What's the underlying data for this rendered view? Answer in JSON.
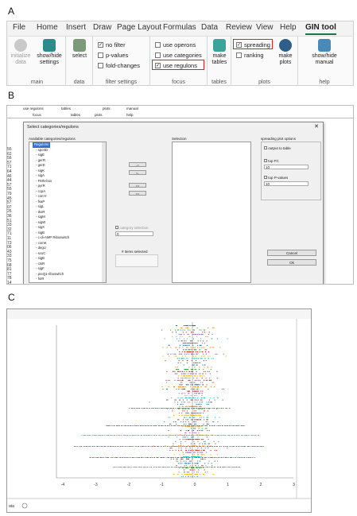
{
  "labels": {
    "a": "A",
    "b": "B",
    "c": "C"
  },
  "ribbon": {
    "tabs": [
      "File",
      "Home",
      "Insert",
      "Draw",
      "Page Layout",
      "Formulas",
      "Data",
      "Review",
      "View",
      "Help",
      "GIN tool"
    ],
    "active_tab": "GIN tool",
    "groups": {
      "main": "main",
      "data": "data",
      "filter": "filter settings",
      "focus": "focus",
      "tables": "tables",
      "plots": "plots",
      "help": "help"
    },
    "buttons": {
      "initialize": "initialize data",
      "showhide": "show/hide settings",
      "select": "select",
      "make_tables": "make tables",
      "make_plots": "make plots",
      "manual": "show/hide manual"
    },
    "checks": {
      "no_filter": "no filter",
      "pvalues": "p-values",
      "fold": "fold-changes",
      "operons": "use operons",
      "categories": "use categories",
      "regulons": "use regulons",
      "spreading": "spreading",
      "ranking": "ranking"
    },
    "colors": {
      "accent": "#217346",
      "highlight": "#d22222"
    }
  },
  "dialog": {
    "title": "Select categories/regulons",
    "close": "✕",
    "available_label": "Available categories/regulons",
    "selection_label": "Selection",
    "options_label": "spreading plot options",
    "output_table": "output to table",
    "top_fc": "top FC",
    "top_fc_val": "10",
    "top_p": "top P-values",
    "top_p_val": "10",
    "category_selection": "category selection",
    "category_val": "0",
    "items_selected": "# items selected",
    "cancel": "Cancel",
    "ok": "Ok",
    "bg_headers": [
      "use regulons",
      "tables",
      "plots",
      "manual",
      "focus",
      "tables",
      "plots",
      "help"
    ],
    "row_numbers": [
      "55",
      "62",
      "56",
      "57",
      "71",
      "64",
      "46",
      "44",
      "57",
      "55",
      "79",
      "45",
      "57",
      "07",
      "26",
      "36",
      "51",
      "33",
      "32",
      "71",
      "11",
      "73",
      "06",
      "43",
      "33",
      "75",
      "68",
      "81",
      "77",
      "78",
      "14"
    ],
    "items": [
      "Regulons",
      "spoIID",
      "sigE",
      "gerR",
      "gerE",
      "sigK",
      "sigA",
      "FMN-box",
      "pyrR",
      "ccpA",
      "comY",
      "fsaP",
      "sigL",
      "tkoR",
      "sigM",
      "sigW",
      "sigX",
      "sigB",
      "c-di-AMP Riboswitch",
      "comK",
      "degU",
      "scuC",
      "sigB",
      "ctsR",
      "sigF",
      "preQ1-riboswitch",
      "fsrR"
    ],
    "arrows": [
      "->",
      "<-",
      ">>",
      "<<"
    ]
  },
  "plot": {
    "xticks": [
      "-4",
      "-3",
      "-2",
      "-1",
      "0",
      "1",
      "2",
      "3"
    ],
    "sheet": "ata",
    "colors": [
      "#1f77b4",
      "#ff7f0e",
      "#2ca02c",
      "#d62728",
      "#9467bd",
      "#f2b400",
      "#17becf",
      "#8c564b",
      "#7f7f7f"
    ]
  }
}
